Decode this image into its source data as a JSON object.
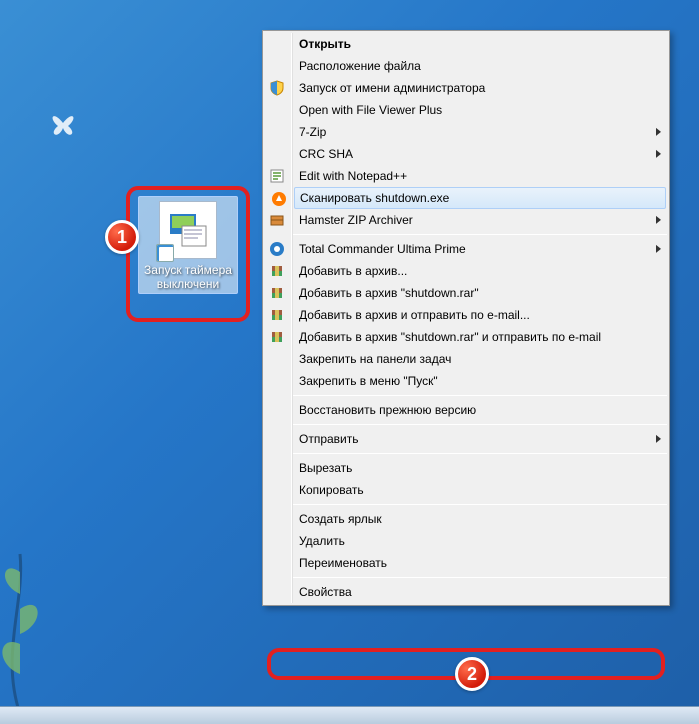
{
  "desktop_icon": {
    "label": "Запуск таймера выключени"
  },
  "badges": {
    "one": "1",
    "two": "2"
  },
  "context_menu": {
    "items": [
      {
        "label": "Открыть",
        "icon": null,
        "submenu": false,
        "bold": true
      },
      {
        "label": "Расположение файла",
        "icon": null,
        "submenu": false
      },
      {
        "label": "Запуск от имени администратора",
        "icon": "shield-icon",
        "submenu": false
      },
      {
        "label": "Open with File Viewer Plus",
        "icon": null,
        "submenu": false
      },
      {
        "label": "7-Zip",
        "icon": null,
        "submenu": true
      },
      {
        "label": "CRC SHA",
        "icon": null,
        "submenu": true
      },
      {
        "label": "Edit with Notepad++",
        "icon": "notepad-icon",
        "submenu": false
      },
      {
        "label": "Сканировать shutdown.exe",
        "icon": "avast-icon",
        "submenu": false,
        "hovered": true
      },
      {
        "label": "Hamster ZIP Archiver",
        "icon": "hamster-icon",
        "submenu": true
      },
      {
        "type": "separator"
      },
      {
        "label": "Total Commander Ultima Prime",
        "icon": "tc-icon",
        "submenu": true
      },
      {
        "label": "Добавить в архив...",
        "icon": "winrar-icon",
        "submenu": false
      },
      {
        "label": "Добавить в архив \"shutdown.rar\"",
        "icon": "winrar-icon",
        "submenu": false
      },
      {
        "label": "Добавить в архив и отправить по e-mail...",
        "icon": "winrar-icon",
        "submenu": false
      },
      {
        "label": "Добавить в архив \"shutdown.rar\" и отправить по e-mail",
        "icon": "winrar-icon",
        "submenu": false
      },
      {
        "label": "Закрепить на панели задач",
        "icon": null,
        "submenu": false
      },
      {
        "label": "Закрепить в меню \"Пуск\"",
        "icon": null,
        "submenu": false
      },
      {
        "type": "separator"
      },
      {
        "label": "Восстановить прежнюю версию",
        "icon": null,
        "submenu": false
      },
      {
        "type": "separator"
      },
      {
        "label": "Отправить",
        "icon": null,
        "submenu": true
      },
      {
        "type": "separator"
      },
      {
        "label": "Вырезать",
        "icon": null,
        "submenu": false
      },
      {
        "label": "Копировать",
        "icon": null,
        "submenu": false
      },
      {
        "type": "separator"
      },
      {
        "label": "Создать ярлык",
        "icon": null,
        "submenu": false
      },
      {
        "label": "Удалить",
        "icon": null,
        "submenu": false
      },
      {
        "label": "Переименовать",
        "icon": null,
        "submenu": false
      },
      {
        "type": "separator"
      },
      {
        "label": "Свойства",
        "icon": null,
        "submenu": false
      }
    ]
  }
}
